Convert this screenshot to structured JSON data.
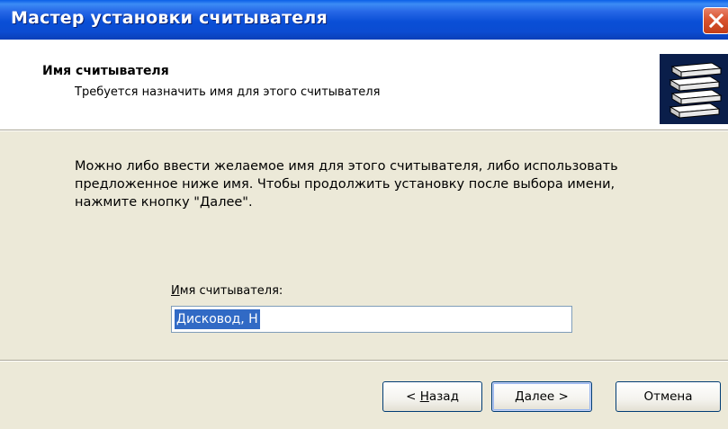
{
  "window": {
    "title": "Мастер установки считывателя"
  },
  "header": {
    "title": "Имя считывателя",
    "subtitle": "Требуется назначить имя для этого считывателя",
    "icon": "reader-stack-icon"
  },
  "body": {
    "description_lines": [
      "Можно либо ввести желаемое имя для этого считывателя, либо использовать",
      "предложенное ниже имя. Чтобы продолжить установку после выбора имени,",
      "нажмите кнопку \"Далее\"."
    ],
    "field": {
      "label_accel": "И",
      "label_rest": "мя считывателя:",
      "value": "Дисковод, H"
    }
  },
  "buttons": {
    "back_prefix": "< ",
    "back_accel": "Н",
    "back_rest": "азад",
    "next_accel": "Д",
    "next_rest": "алее >",
    "cancel": "Отмена"
  },
  "colors": {
    "titlebar": "#0A4FD6",
    "selection": "#316AC5",
    "dialog_bg": "#ECE9D8",
    "close_button": "#D9532F"
  }
}
